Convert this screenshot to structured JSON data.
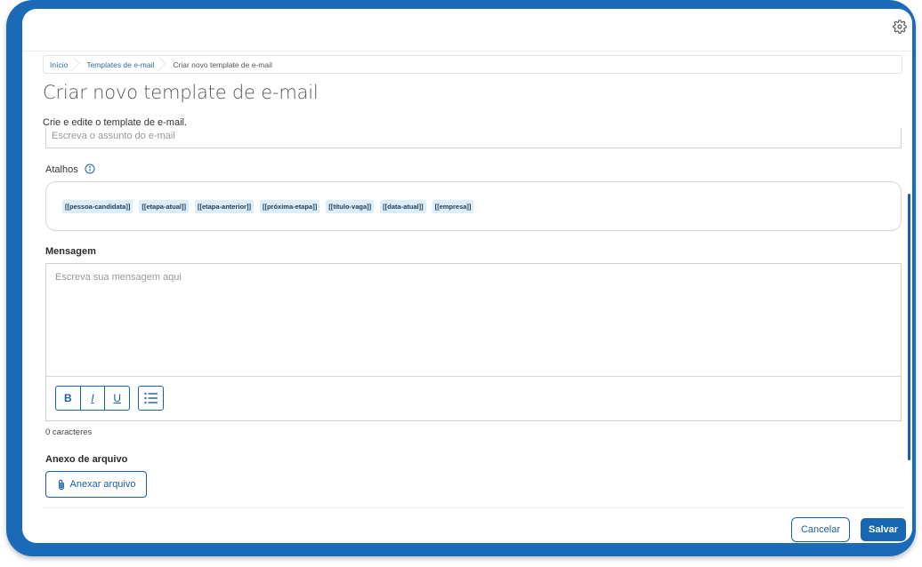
{
  "colors": {
    "frame": "#1a6ab8",
    "accent": "#1a5fa3",
    "chip_bg": "#dceefa"
  },
  "header": {
    "settings_icon": "gear-icon"
  },
  "breadcrumb": [
    "Início",
    "Templates de e-mail",
    "Criar novo template de e-mail"
  ],
  "page": {
    "title": "Criar novo template de e-mail",
    "subtitle": "Crie e edite o template de e-mail."
  },
  "subject": {
    "placeholder": "Escreva o assunto do e-mail"
  },
  "shortcuts": {
    "label": "Atalhos",
    "items": [
      "[[pessoa-candidata]]",
      "[[etapa-atual]]",
      "[[etapa-anterior]]",
      "[[próxima-etapa]]",
      "[[título-vaga]]",
      "[[data-atual]]",
      "[[empresa]]"
    ]
  },
  "message": {
    "label": "Mensagem",
    "placeholder": "Escreva sua mensagem aqui",
    "toolbar": {
      "bold": "B",
      "italic": "I",
      "underline": "U"
    },
    "counter": "0 caracteres"
  },
  "attachment": {
    "label": "Anexo de arquivo",
    "button": "Anexar arquivo"
  },
  "footer": {
    "cancel": "Cancelar",
    "save": "Salvar"
  }
}
